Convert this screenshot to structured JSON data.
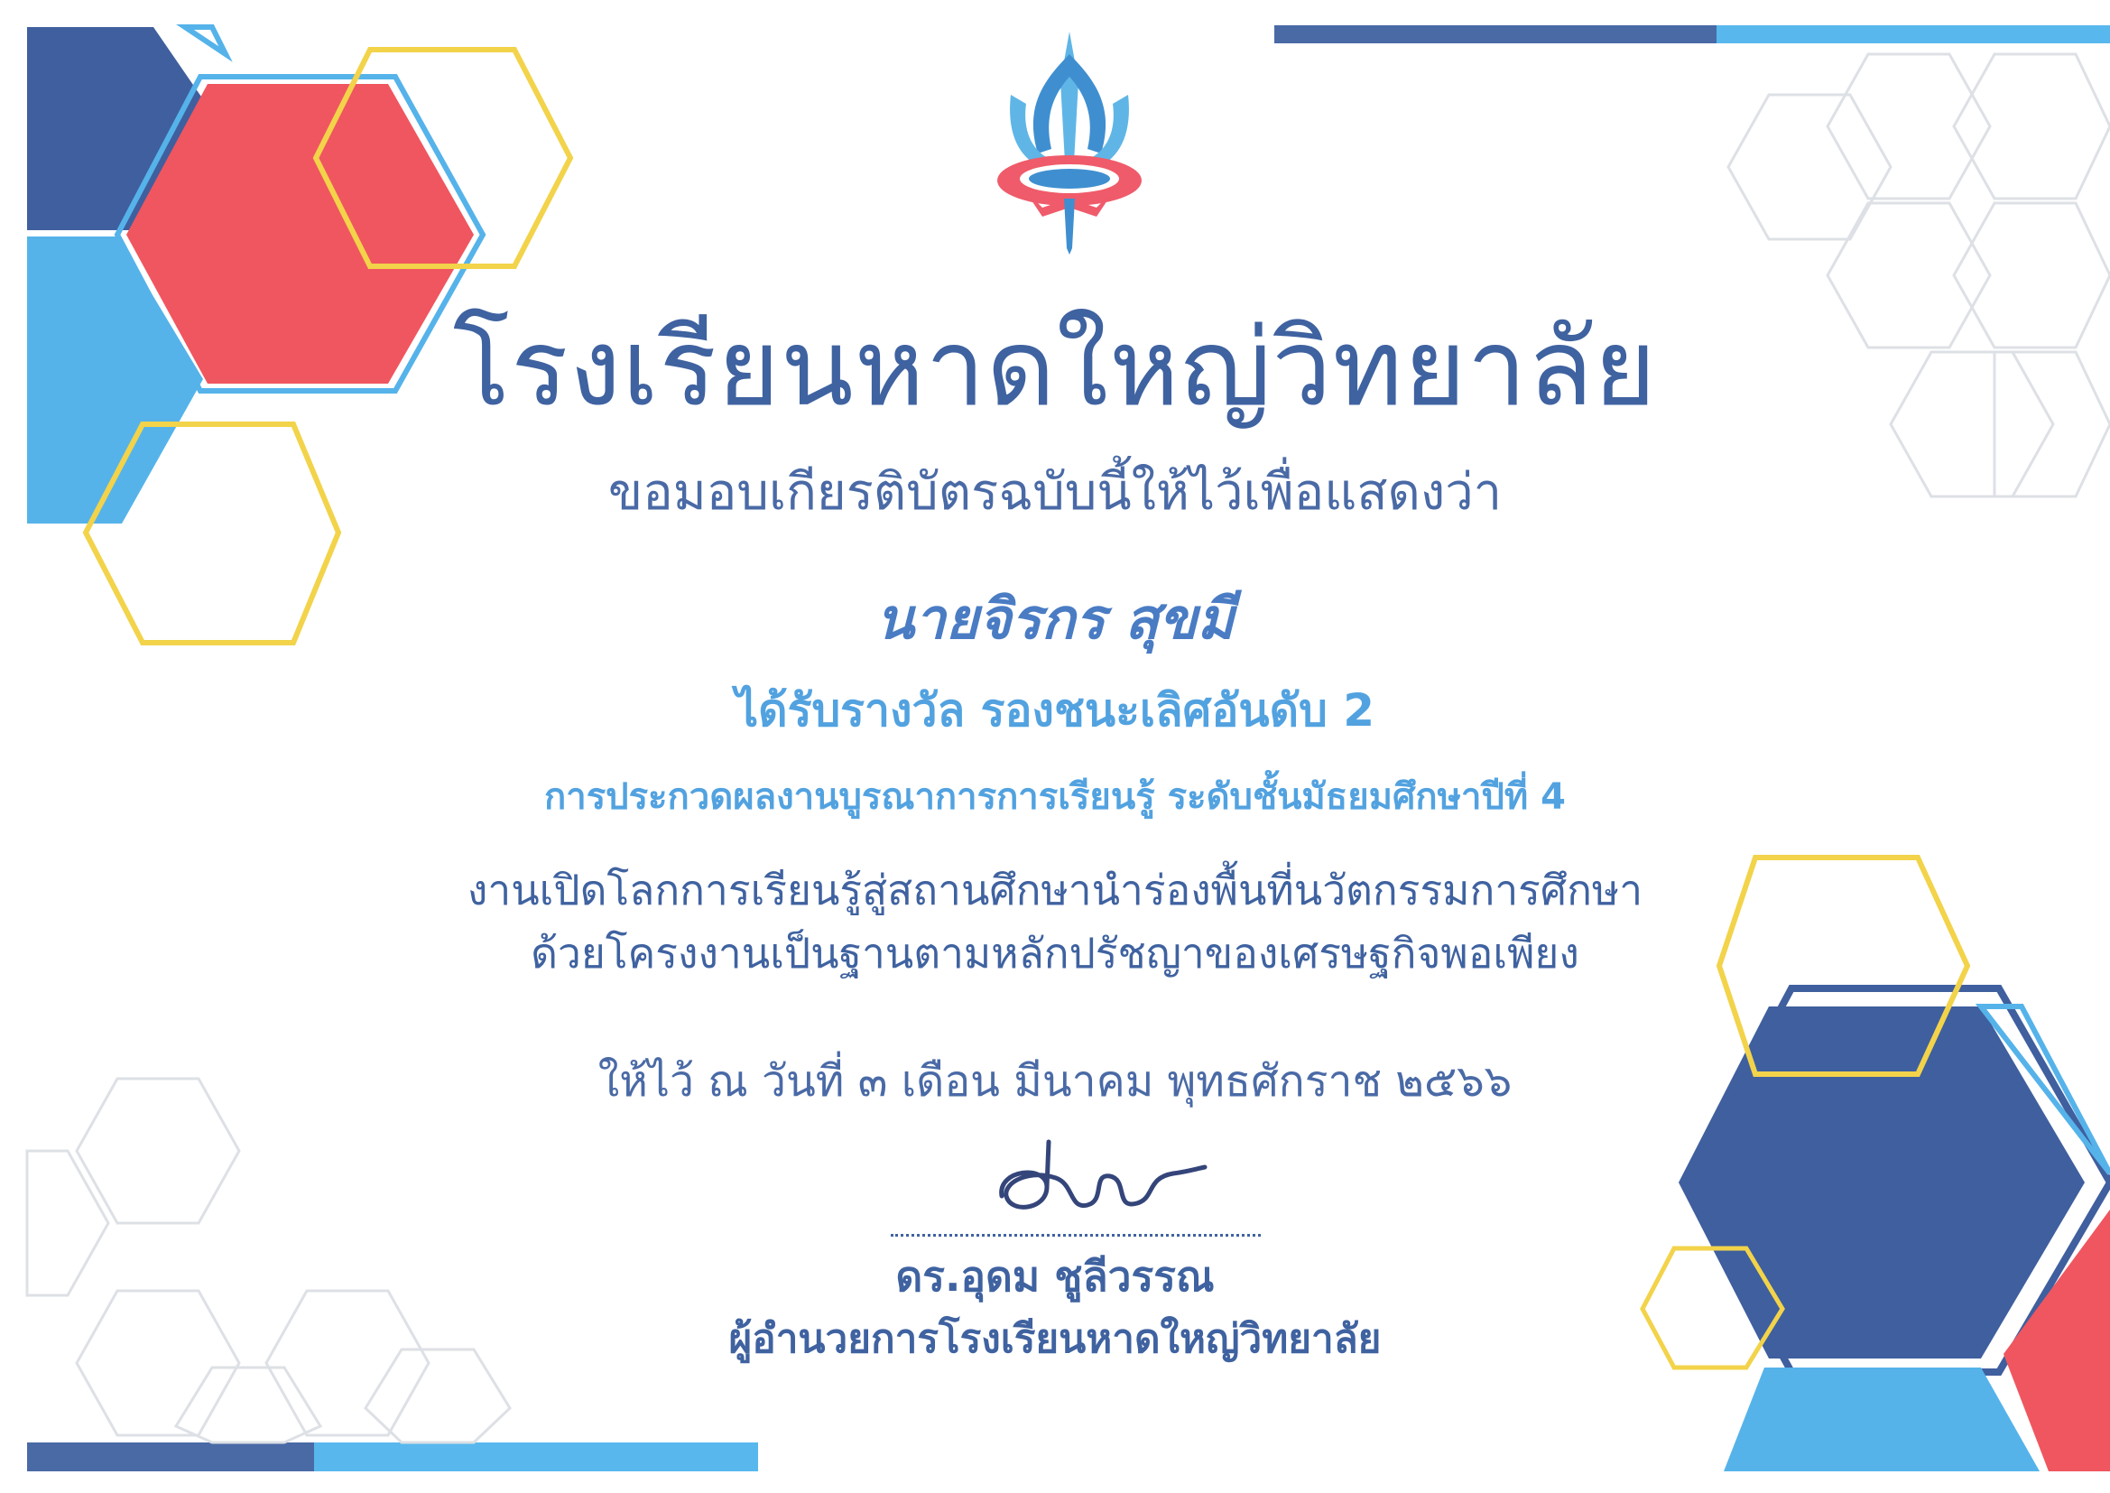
{
  "certificate": {
    "school_name": "โรงเรียนหาดใหญ่วิทยาลัย",
    "intro": "ขอมอบเกียรติบัตรฉบับนี้ให้ไว้เพื่อแสดงว่า",
    "recipient": "นายจิรกร สุขมี",
    "award": "ได้รับรางวัล รองชนะเลิศอันดับ 2",
    "contest": "การประกวดผลงานบูรณาการการเรียนรู้ ระดับชั้นมัธยมศึกษาปีที่ 4",
    "event_line_1": "งานเปิดโลกการเรียนรู้สู่สถานศึกษานำร่องพื้นที่นวัตกรรมการศึกษา",
    "event_line_2": "ด้วยโครงงานเป็นฐานตามหลักปรัชญาของเศรษฐกิจพอเพียง",
    "date_line": "ให้ไว้ ณ วันที่ ๓ เดือน มีนาคม พุทธศักราช ๒๕๖๖",
    "signer_name": "ดร.อุดม ชูลีวรรณ",
    "signer_title": "ผู้อำนวยการโรงเรียนหาดใหญ่วิทยาลัย"
  },
  "colors": {
    "navy": "#3f62a0",
    "sky": "#4db3ea",
    "red": "#f0565f",
    "gold": "#f2d34a",
    "grey_outline": "#d9dde3"
  },
  "icons": {
    "emblem": "trident-emblem-icon",
    "signature": "handwritten-signature"
  }
}
